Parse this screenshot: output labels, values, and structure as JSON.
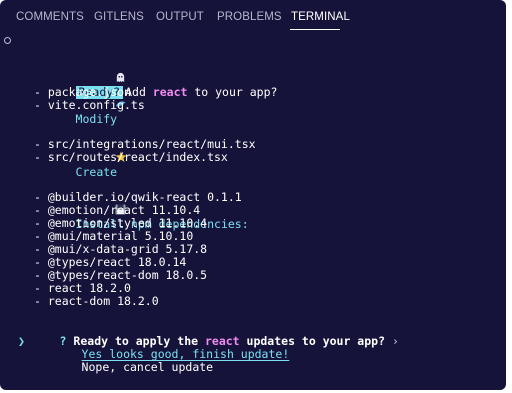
{
  "panel": {
    "tabs": [
      {
        "label": "COMMENTS",
        "active": false
      },
      {
        "label": "GITLENS",
        "active": false
      },
      {
        "label": "OUTPUT",
        "active": false
      },
      {
        "label": "PROBLEMS",
        "active": false
      },
      {
        "label": "TERMINAL",
        "active": true
      }
    ]
  },
  "terminal": {
    "prompt": {
      "badge": "Ready?",
      "text_before": "Add ",
      "keyword": "react",
      "text_after": " to your app?"
    },
    "modify": {
      "title": "Modify",
      "files": [
        "- package.json",
        "- vite.config.ts"
      ]
    },
    "create": {
      "title": "Create",
      "files": [
        "- src/integrations/react/mui.tsx",
        "- src/routes/react/index.tsx"
      ]
    },
    "install": {
      "title": "Install npm dependencies:",
      "deps": [
        "- @builder.io/qwik-react 0.1.1",
        "- @emotion/react 11.10.4",
        "- @emotion/styled 11.10.4",
        "- @mui/material 5.10.10",
        "- @mui/x-data-grid 5.17.8",
        "- @types/react 18.0.14",
        "- @types/react-dom 18.0.5",
        "- react 18.2.0",
        "- react-dom 18.2.0"
      ]
    },
    "question": {
      "mark": "?",
      "text_before": "Ready to apply the ",
      "keyword": "react",
      "text_after": " updates to your app?",
      "chevron": "›"
    },
    "options": {
      "pointer": "❯",
      "selected": "Yes looks good, finish update!",
      "other": "Nope, cancel update"
    }
  },
  "colors": {
    "background": "#16133a",
    "accent_cyan": "#7ae0f0",
    "keyword_pink": "#f08bf0"
  },
  "icons": {
    "prompt": "ghost-icon",
    "modify": "dolphin-icon",
    "create": "star-icon",
    "install": "floppy-disk-icon"
  }
}
